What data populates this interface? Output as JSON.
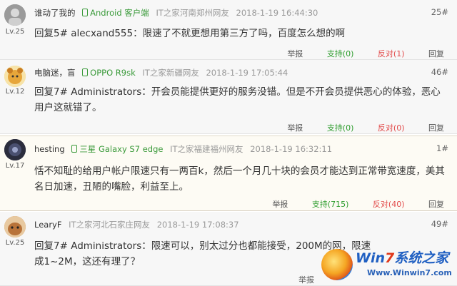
{
  "comments": [
    {
      "user": "谁动了我的",
      "level": "Lv.25",
      "device": "Android 客户端",
      "location": "IT之家河南郑州网友",
      "time": "2018-1-19 16:44:30",
      "floor": "25#",
      "text": "回复5# alecxand555：限速了不就更想用第三方了吗，百度怎么想的啊",
      "report": "举报",
      "support": "支持(0)",
      "oppose": "反对(1)",
      "reply": "回复"
    },
    {
      "user": "电脑迷，盲",
      "level": "Lv.12",
      "device": "OPPO R9sk",
      "location": "IT之家新疆网友",
      "time": "2018-1-19 17:05:44",
      "floor": "46#",
      "text": "回复7# Administrators：开会员能提供更好的服务没错。但是不开会员提供恶心的体验，恶心用户这就错了。",
      "report": "举报",
      "support": "支持(0)",
      "oppose": "反对(0)",
      "reply": "回复"
    },
    {
      "user": "hesting",
      "level": "Lv.17",
      "device": "三星 Galaxy S7 edge",
      "location": "IT之家福建福州网友",
      "time": "2018-1-19 16:32:11",
      "floor": "1#",
      "text": "恬不知耻的给用户帐户限速只有一两百k，然后一个月几十块的会员才能达到正常带宽速度，美其名日加速，丑陋的嘴脸，利益至上。",
      "report": "举报",
      "support": "支持(715)",
      "oppose": "反对(40)",
      "reply": "回复"
    },
    {
      "user": "LearyF",
      "level": "Lv.25",
      "device": "",
      "location": "IT之家河北石家庄网友",
      "time": "2018-1-19 17:08:37",
      "floor": "49#",
      "text": "回复7# Administrators：限速可以，别太过分也都能接受，200M的网，限速成1~2M，这还有理了？",
      "report": "举报",
      "support": "",
      "oppose": "",
      "reply": ""
    }
  ],
  "watermark": {
    "title_a": "Win",
    "title_7": "7",
    "title_b": "系统之家",
    "url": "Www.Winwin7.com"
  },
  "colors": {
    "device": "#3a9a3a",
    "support": "#2e9d2e",
    "oppose": "#e24a4a"
  }
}
